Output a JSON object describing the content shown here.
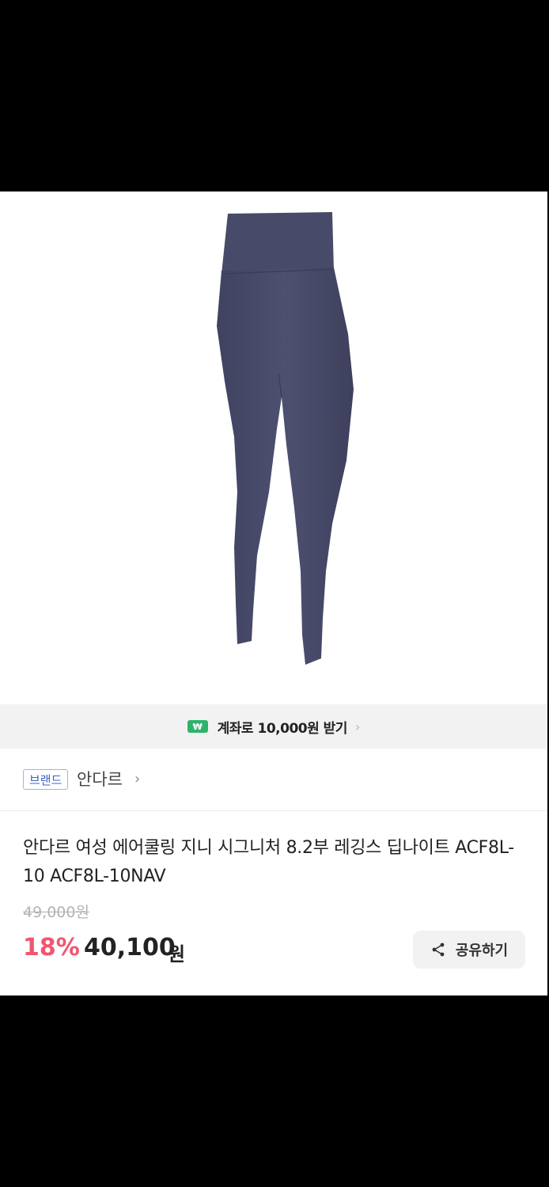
{
  "promo": {
    "badge": "₩",
    "text": "계좌로 10,000원 받기",
    "chevron": "›"
  },
  "brand": {
    "tag": "브랜드",
    "name": "안다르",
    "chevron": "›"
  },
  "product": {
    "title": "안다르 여성 에어쿨링 지니 시그니처 8.2부 레깅스 딥나이트 ACF8L-10 ACF8L-10NAV",
    "original_price": "49,000원",
    "discount_rate": "18%",
    "price": "40,100",
    "price_unit": "원",
    "image_color": "#4a4d6b"
  },
  "share": {
    "label": "공유하기",
    "icon": "share-icon"
  },
  "colors": {
    "discount": "#f0566f",
    "badge_green": "#2fb36b",
    "brand_tag": "#3f63c6"
  }
}
